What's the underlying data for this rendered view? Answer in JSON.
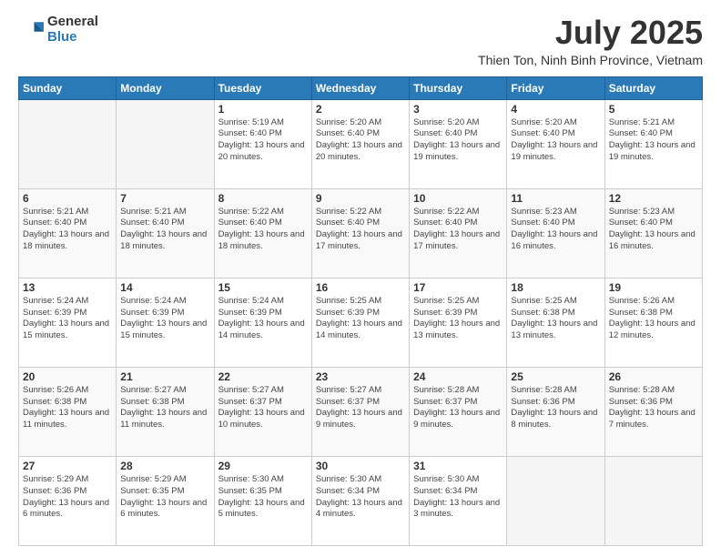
{
  "logo": {
    "general": "General",
    "blue": "Blue"
  },
  "header": {
    "title": "July 2025",
    "subtitle": "Thien Ton, Ninh Binh Province, Vietnam"
  },
  "days_of_week": [
    "Sunday",
    "Monday",
    "Tuesday",
    "Wednesday",
    "Thursday",
    "Friday",
    "Saturday"
  ],
  "weeks": [
    [
      {
        "day": "",
        "info": ""
      },
      {
        "day": "",
        "info": ""
      },
      {
        "day": "1",
        "info": "Sunrise: 5:19 AM\nSunset: 6:40 PM\nDaylight: 13 hours and 20 minutes."
      },
      {
        "day": "2",
        "info": "Sunrise: 5:20 AM\nSunset: 6:40 PM\nDaylight: 13 hours and 20 minutes."
      },
      {
        "day": "3",
        "info": "Sunrise: 5:20 AM\nSunset: 6:40 PM\nDaylight: 13 hours and 19 minutes."
      },
      {
        "day": "4",
        "info": "Sunrise: 5:20 AM\nSunset: 6:40 PM\nDaylight: 13 hours and 19 minutes."
      },
      {
        "day": "5",
        "info": "Sunrise: 5:21 AM\nSunset: 6:40 PM\nDaylight: 13 hours and 19 minutes."
      }
    ],
    [
      {
        "day": "6",
        "info": "Sunrise: 5:21 AM\nSunset: 6:40 PM\nDaylight: 13 hours and 18 minutes."
      },
      {
        "day": "7",
        "info": "Sunrise: 5:21 AM\nSunset: 6:40 PM\nDaylight: 13 hours and 18 minutes."
      },
      {
        "day": "8",
        "info": "Sunrise: 5:22 AM\nSunset: 6:40 PM\nDaylight: 13 hours and 18 minutes."
      },
      {
        "day": "9",
        "info": "Sunrise: 5:22 AM\nSunset: 6:40 PM\nDaylight: 13 hours and 17 minutes."
      },
      {
        "day": "10",
        "info": "Sunrise: 5:22 AM\nSunset: 6:40 PM\nDaylight: 13 hours and 17 minutes."
      },
      {
        "day": "11",
        "info": "Sunrise: 5:23 AM\nSunset: 6:40 PM\nDaylight: 13 hours and 16 minutes."
      },
      {
        "day": "12",
        "info": "Sunrise: 5:23 AM\nSunset: 6:40 PM\nDaylight: 13 hours and 16 minutes."
      }
    ],
    [
      {
        "day": "13",
        "info": "Sunrise: 5:24 AM\nSunset: 6:39 PM\nDaylight: 13 hours and 15 minutes."
      },
      {
        "day": "14",
        "info": "Sunrise: 5:24 AM\nSunset: 6:39 PM\nDaylight: 13 hours and 15 minutes."
      },
      {
        "day": "15",
        "info": "Sunrise: 5:24 AM\nSunset: 6:39 PM\nDaylight: 13 hours and 14 minutes."
      },
      {
        "day": "16",
        "info": "Sunrise: 5:25 AM\nSunset: 6:39 PM\nDaylight: 13 hours and 14 minutes."
      },
      {
        "day": "17",
        "info": "Sunrise: 5:25 AM\nSunset: 6:39 PM\nDaylight: 13 hours and 13 minutes."
      },
      {
        "day": "18",
        "info": "Sunrise: 5:25 AM\nSunset: 6:38 PM\nDaylight: 13 hours and 13 minutes."
      },
      {
        "day": "19",
        "info": "Sunrise: 5:26 AM\nSunset: 6:38 PM\nDaylight: 13 hours and 12 minutes."
      }
    ],
    [
      {
        "day": "20",
        "info": "Sunrise: 5:26 AM\nSunset: 6:38 PM\nDaylight: 13 hours and 11 minutes."
      },
      {
        "day": "21",
        "info": "Sunrise: 5:27 AM\nSunset: 6:38 PM\nDaylight: 13 hours and 11 minutes."
      },
      {
        "day": "22",
        "info": "Sunrise: 5:27 AM\nSunset: 6:37 PM\nDaylight: 13 hours and 10 minutes."
      },
      {
        "day": "23",
        "info": "Sunrise: 5:27 AM\nSunset: 6:37 PM\nDaylight: 13 hours and 9 minutes."
      },
      {
        "day": "24",
        "info": "Sunrise: 5:28 AM\nSunset: 6:37 PM\nDaylight: 13 hours and 9 minutes."
      },
      {
        "day": "25",
        "info": "Sunrise: 5:28 AM\nSunset: 6:36 PM\nDaylight: 13 hours and 8 minutes."
      },
      {
        "day": "26",
        "info": "Sunrise: 5:28 AM\nSunset: 6:36 PM\nDaylight: 13 hours and 7 minutes."
      }
    ],
    [
      {
        "day": "27",
        "info": "Sunrise: 5:29 AM\nSunset: 6:36 PM\nDaylight: 13 hours and 6 minutes."
      },
      {
        "day": "28",
        "info": "Sunrise: 5:29 AM\nSunset: 6:35 PM\nDaylight: 13 hours and 6 minutes."
      },
      {
        "day": "29",
        "info": "Sunrise: 5:30 AM\nSunset: 6:35 PM\nDaylight: 13 hours and 5 minutes."
      },
      {
        "day": "30",
        "info": "Sunrise: 5:30 AM\nSunset: 6:34 PM\nDaylight: 13 hours and 4 minutes."
      },
      {
        "day": "31",
        "info": "Sunrise: 5:30 AM\nSunset: 6:34 PM\nDaylight: 13 hours and 3 minutes."
      },
      {
        "day": "",
        "info": ""
      },
      {
        "day": "",
        "info": ""
      }
    ]
  ]
}
